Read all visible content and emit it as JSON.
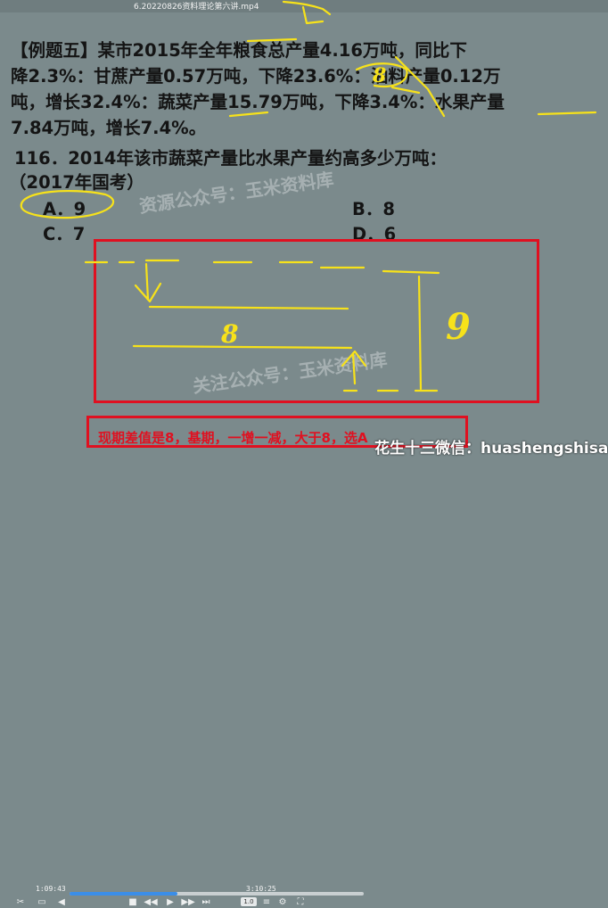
{
  "window": {
    "filename": "6.20220826资料理论第六讲.mp4"
  },
  "question": {
    "lines": [
      "【例题五】某市2015年全年粮食总产量4.16万吨，同比下",
      "降2.3%：甘蔗产量0.57万吨，下降23.6%：油料产量0.12万",
      "吨，增长32.4%：蔬菜产量15.79万吨，下降3.4%：水果产量",
      "7.84万吨，增长7.4%。"
    ],
    "sub_line1": "116．2014年该市蔬菜产量比水果产量约高多少万吨：",
    "sub_line2": "（2017年国考）"
  },
  "options": {
    "a": "A．9",
    "b": "B．8",
    "c": "C．7",
    "d": "D．6"
  },
  "watermarks": {
    "w1": "资源公众号：玉米资料库",
    "w2": "关注公众号：玉米资料库"
  },
  "annotations": {
    "handwritten_digit_8": "8",
    "handwritten_digit_9": "9",
    "handwritten_digit_8b": "8"
  },
  "caption": {
    "text": "现期差值是8，基期，一增一减，大于8，选A",
    "wechat": "花生十三微信：huashengshisan"
  },
  "player": {
    "time_current": "1:09:43",
    "time_total": "3:10:25",
    "progress_percent": 36.6,
    "speed_label": "1.0"
  },
  "colors": {
    "background": "#7b8a8c",
    "annotation_yellow": "#f7e21a",
    "red_box": "#e01020"
  }
}
